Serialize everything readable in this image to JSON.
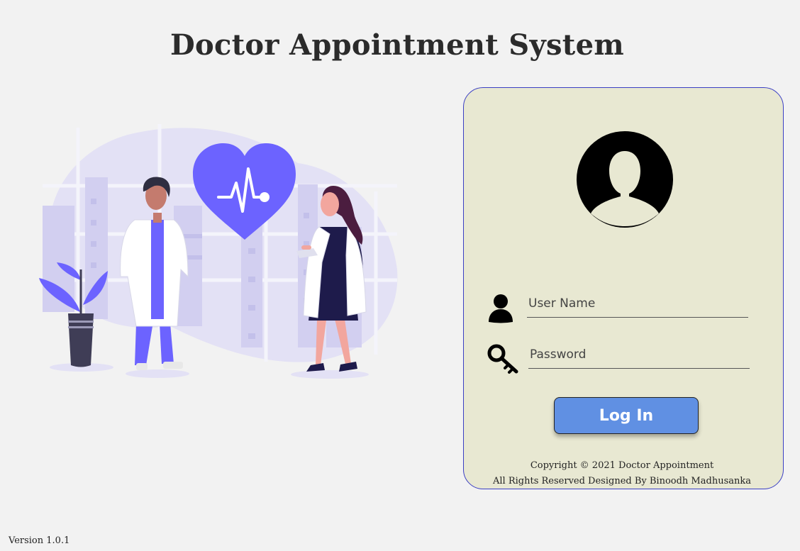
{
  "page": {
    "title": "Doctor Appointment System",
    "version": "Version 1.0.1"
  },
  "login": {
    "username_placeholder": "User Name",
    "username_value": "",
    "password_placeholder": "Password",
    "password_value": "",
    "login_label": "Log In",
    "copyright_line1": "Copyright © 2021 Doctor Appointment",
    "copyright_line2": "All Rights Reserved Designed By Binoodh Madhusanka"
  },
  "icons": {
    "avatar": "user-avatar-icon",
    "username": "user-icon",
    "password": "key-icon",
    "illustration_heart": "heartbeat-icon"
  },
  "colors": {
    "background": "#f2f2f2",
    "card": "#e8e8d2",
    "card_border": "#3b3fc4",
    "button": "#6090e3",
    "accent_purple": "#6c63ff"
  }
}
